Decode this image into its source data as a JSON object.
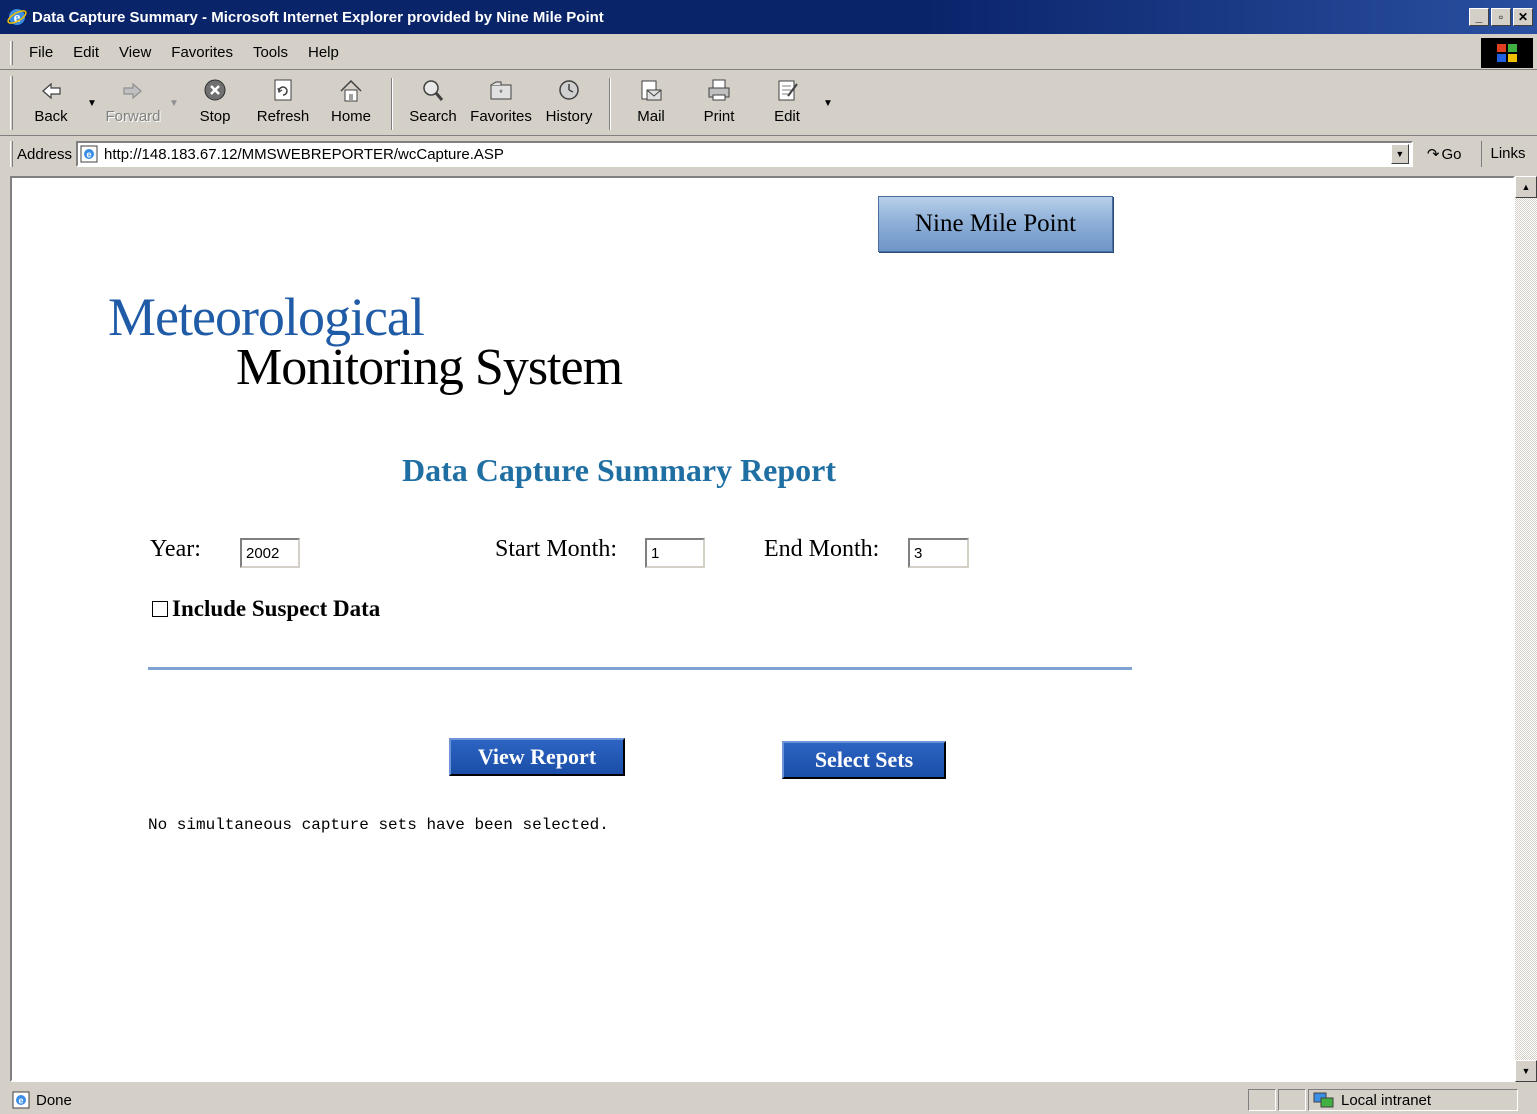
{
  "window": {
    "title": "Data Capture Summary - Microsoft Internet Explorer provided by Nine Mile Point"
  },
  "menu": [
    "File",
    "Edit",
    "View",
    "Favorites",
    "Tools",
    "Help"
  ],
  "toolbar": {
    "back": "Back",
    "forward": "Forward",
    "stop": "Stop",
    "refresh": "Refresh",
    "home": "Home",
    "search": "Search",
    "favorites": "Favorites",
    "history": "History",
    "mail": "Mail",
    "print": "Print",
    "edit": "Edit"
  },
  "address": {
    "label": "Address",
    "url": "http://148.183.67.12/MMSWEBREPORTER/wcCapture.ASP",
    "go": "Go",
    "links": "Links »"
  },
  "page": {
    "site_button": "Nine Mile Point",
    "logo_line1": "Meteorological",
    "logo_line2": "Monitoring System",
    "report_title": "Data Capture Summary Report",
    "year_label": "Year:",
    "year_value": "2002",
    "start_month_label": "Start Month:",
    "start_month_value": "1",
    "end_month_label": "End Month:",
    "end_month_value": "3",
    "suspect_label": "Include Suspect Data",
    "suspect_checked": false,
    "view_report": "View Report",
    "select_sets": "Select Sets",
    "status_message": "No simultaneous capture sets have been selected."
  },
  "statusbar": {
    "status": "Done",
    "zone": "Local intranet"
  }
}
